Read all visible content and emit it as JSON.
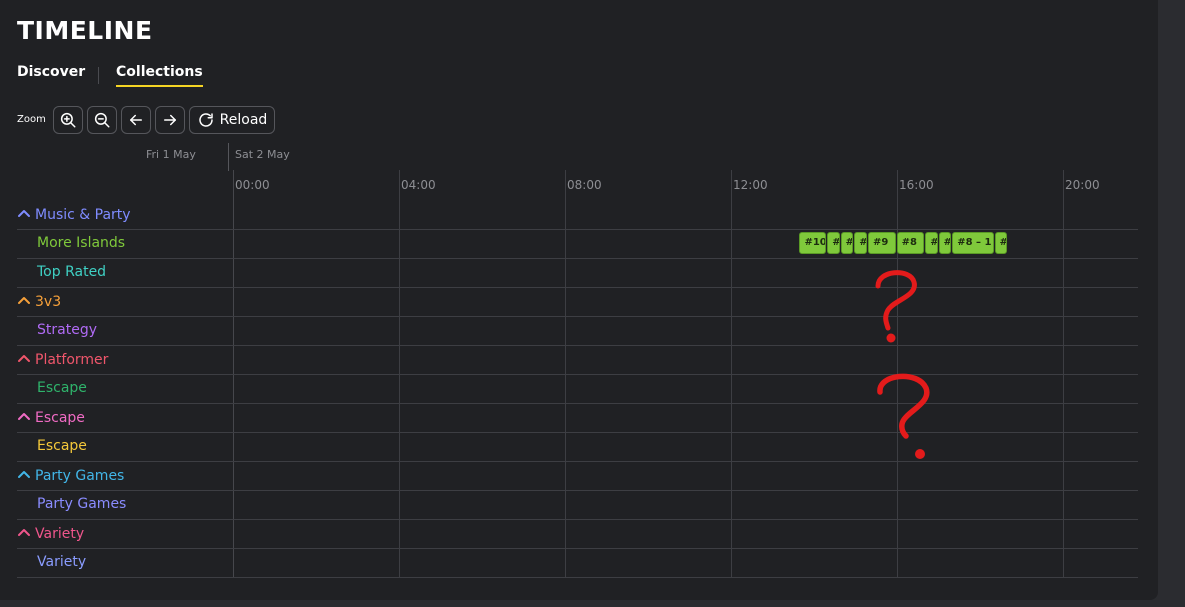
{
  "page": {
    "title": "TIMELINE"
  },
  "tabs": [
    {
      "label": "Discover",
      "active": false
    },
    {
      "label": "Collections",
      "active": true
    }
  ],
  "toolbar": {
    "zoom_label": "Zoom",
    "reload_label": "Reload",
    "icons": [
      "zoom-in-icon",
      "zoom-out-icon",
      "arrow-left-icon",
      "arrow-right-icon",
      "reload-icon"
    ]
  },
  "dates": {
    "prev": "Fri 1 May",
    "current": "Sat 2 May"
  },
  "hours": [
    "00:00",
    "04:00",
    "08:00",
    "12:00",
    "16:00",
    "20:00"
  ],
  "rows": [
    {
      "label": "Music & Party",
      "level": "parent",
      "color": "#7f8cff"
    },
    {
      "label": "More Islands",
      "level": "child",
      "color": "#7fc93b"
    },
    {
      "label": "Top Rated",
      "level": "child",
      "color": "#3fd1c4"
    },
    {
      "label": "3v3",
      "level": "parent",
      "color": "#f5a03a"
    },
    {
      "label": "Strategy",
      "level": "child",
      "color": "#b06bf5"
    },
    {
      "label": "Platformer",
      "level": "parent",
      "color": "#f0566b"
    },
    {
      "label": "Escape",
      "level": "child",
      "color": "#2fb36b"
    },
    {
      "label": "Escape",
      "level": "parent",
      "color": "#f06bc4"
    },
    {
      "label": "Escape",
      "level": "child",
      "color": "#f5c93a"
    },
    {
      "label": "Party Games",
      "level": "parent",
      "color": "#42b6e8"
    },
    {
      "label": "Party Games",
      "level": "child",
      "color": "#8a8cff"
    },
    {
      "label": "Variety",
      "level": "parent",
      "color": "#f0568c"
    },
    {
      "label": "Variety",
      "level": "child",
      "color": "#8a9cff"
    }
  ],
  "events": [
    {
      "label": "#10",
      "start_hour": 13.65,
      "end_hour": 14.3
    },
    {
      "label": "#",
      "start_hour": 14.32,
      "end_hour": 14.62
    },
    {
      "label": "#",
      "start_hour": 14.64,
      "end_hour": 14.95
    },
    {
      "label": "#",
      "start_hour": 14.97,
      "end_hour": 15.28
    },
    {
      "label": "#9",
      "start_hour": 15.3,
      "end_hour": 15.97
    },
    {
      "label": "#8",
      "start_hour": 15.99,
      "end_hour": 16.66
    },
    {
      "label": "#",
      "start_hour": 16.68,
      "end_hour": 16.98
    },
    {
      "label": "#",
      "start_hour": 17.0,
      "end_hour": 17.31
    },
    {
      "label": "#8 – 1",
      "start_hour": 17.33,
      "end_hour": 18.33
    },
    {
      "label": "#",
      "start_hour": 18.35,
      "end_hour": 18.66
    }
  ],
  "event_row": 1,
  "annotation_color": "#e31b1b"
}
